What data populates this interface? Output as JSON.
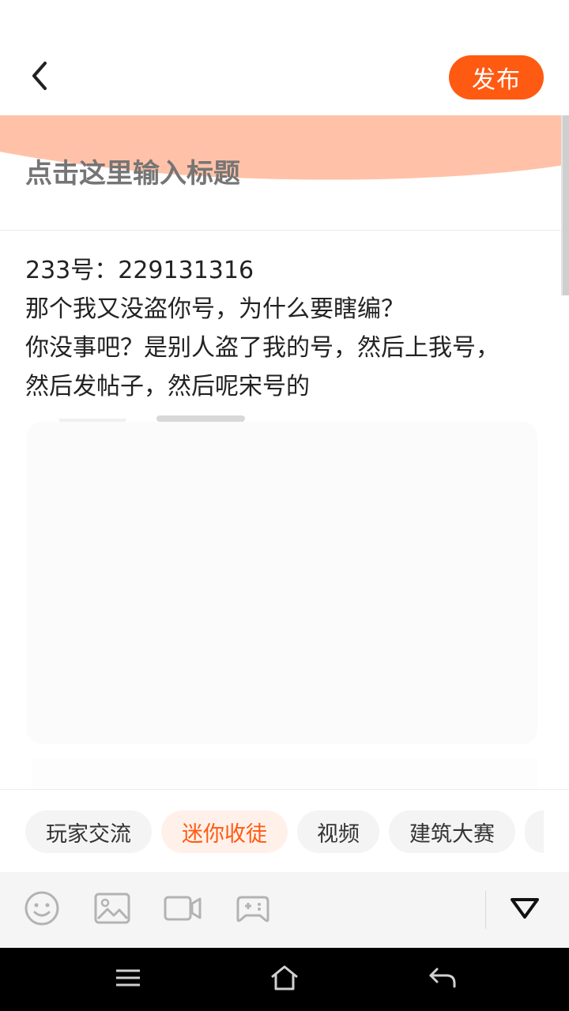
{
  "header": {
    "back_icon": "chevron-left-icon",
    "publish_label": "发布",
    "accent_color": "#ff5a12"
  },
  "editor": {
    "title_placeholder": "点击这里输入标题",
    "body_lines": [
      "233号：229131316",
      "那个我又没盗你号，为什么要瞎编？",
      "你没事吧？是别人盗了我的号，然后上我号，",
      "然后发帖子，然后呢宋号的"
    ]
  },
  "tags": [
    {
      "label": "玩家交流",
      "active": false
    },
    {
      "label": "迷你收徒",
      "active": true
    },
    {
      "label": "视频",
      "active": false
    },
    {
      "label": "建筑大赛",
      "active": false
    }
  ],
  "toolbar": {
    "icons": [
      "emoji-icon",
      "image-icon",
      "video-icon",
      "gamepad-icon"
    ],
    "collapse_icon": "triangle-down-icon"
  },
  "system_nav": {
    "icons": [
      "menu-icon",
      "home-icon",
      "back-arrow-icon"
    ]
  }
}
